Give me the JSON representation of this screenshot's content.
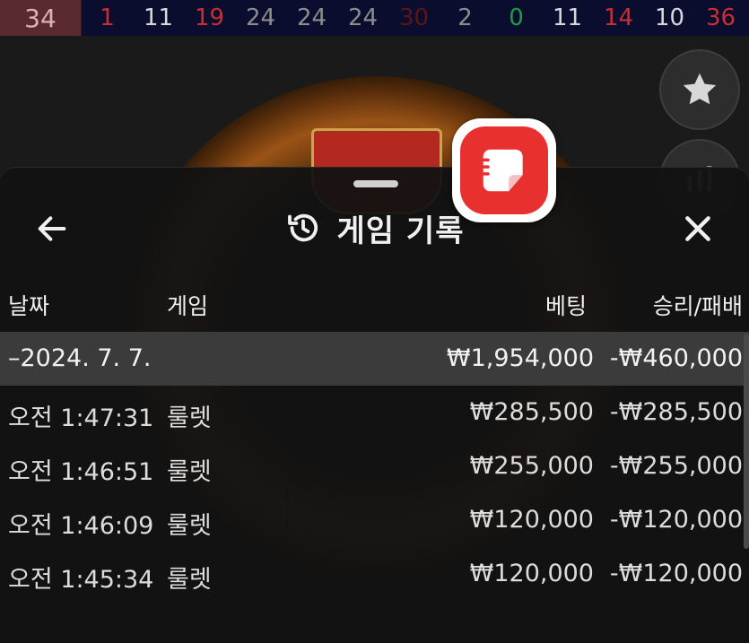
{
  "recent_results": {
    "latest": "34",
    "numbers": [
      {
        "value": "1",
        "color": "red"
      },
      {
        "value": "11",
        "color": "black"
      },
      {
        "value": "19",
        "color": "red"
      },
      {
        "value": "24",
        "color": "dim"
      },
      {
        "value": "24",
        "color": "dim"
      },
      {
        "value": "24",
        "color": "dim"
      },
      {
        "value": "30",
        "color": "dim-red"
      },
      {
        "value": "2",
        "color": "dim"
      },
      {
        "value": "0",
        "color": "green"
      },
      {
        "value": "11",
        "color": "black"
      },
      {
        "value": "14",
        "color": "red"
      },
      {
        "value": "10",
        "color": "black"
      },
      {
        "value": "36",
        "color": "red"
      }
    ]
  },
  "side_buttons": {
    "favorite_icon": "star-icon",
    "stats_icon": "bar-chart-icon"
  },
  "sheet": {
    "title": "게임 기록",
    "title_icon": "history-icon",
    "back_icon": "arrow-left-icon",
    "close_icon": "close-icon"
  },
  "table": {
    "headers": {
      "date": "날짜",
      "game": "게임",
      "bet": "베팅",
      "result": "승리/패배"
    },
    "group": {
      "date": "–2024. 7. 7.",
      "bet": "₩1,954,000",
      "result": "-₩460,000"
    },
    "rows": [
      {
        "time": "오전 1:47:31",
        "game": "룰렛",
        "bet": "₩285,500",
        "result": "-₩285,500"
      },
      {
        "time": "오전 1:46:51",
        "game": "룰렛",
        "bet": "₩255,000",
        "result": "-₩255,000"
      },
      {
        "time": "오전 1:46:09",
        "game": "룰렛",
        "bet": "₩120,000",
        "result": "-₩120,000"
      },
      {
        "time": "오전 1:45:34",
        "game": "룰렛",
        "bet": "₩120,000",
        "result": "-₩120,000"
      }
    ]
  },
  "floating_app": {
    "icon": "memo-app-icon",
    "color": "#e8302f"
  }
}
